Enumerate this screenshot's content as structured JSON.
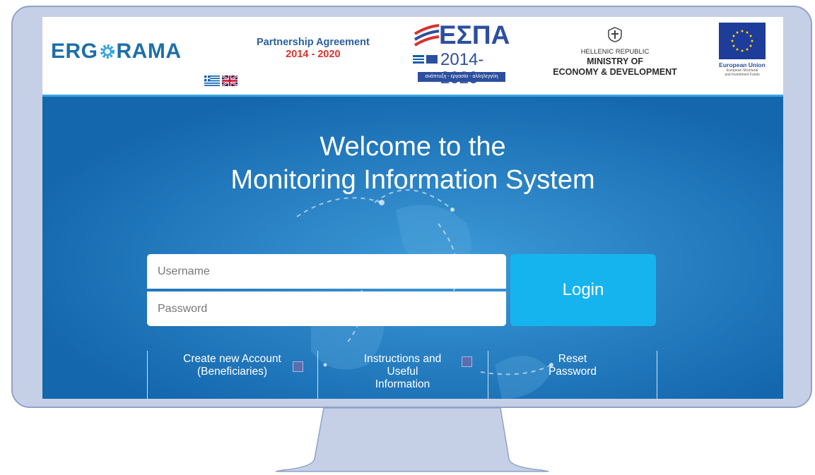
{
  "header": {
    "logo": {
      "text_before": "ERG",
      "text_after": "RAMA"
    },
    "flags": [
      "greek-flag",
      "uk-flag"
    ],
    "partnership": {
      "line1": "Partnership Agreement",
      "line2": "2014 - 2020"
    },
    "espa": {
      "title": "ΕΣΠΑ",
      "years": "2014-2020",
      "subtitle": "ανάπτυξη - εργασία - αλληλεγγύη"
    },
    "ministry": {
      "line1": "HELLENIC REPUBLIC",
      "line2": "MINISTRY OF",
      "line3": "ECONOMY & DEVELOPMENT"
    },
    "eu": {
      "title": "European Union",
      "sub1": "European Structural",
      "sub2": "and Investment Funds"
    }
  },
  "hero": {
    "title_line1": "Welcome to the",
    "title_line2": "Monitoring Information System"
  },
  "login": {
    "username_placeholder": "Username",
    "password_placeholder": "Password",
    "button_label": "Login"
  },
  "links": [
    {
      "line1": "Create new Account",
      "line2": "(Beneficiaries)",
      "line3": ""
    },
    {
      "line1": "Instructions and",
      "line2": "Useful",
      "line3": "Information"
    },
    {
      "line1": "Reset",
      "line2": "Password",
      "line3": ""
    }
  ],
  "colors": {
    "hero_blue": "#1a78be",
    "login_button": "#16b4ee",
    "monitor_frame": "#c5d0e6",
    "brand_blue": "#1d6fa8"
  }
}
